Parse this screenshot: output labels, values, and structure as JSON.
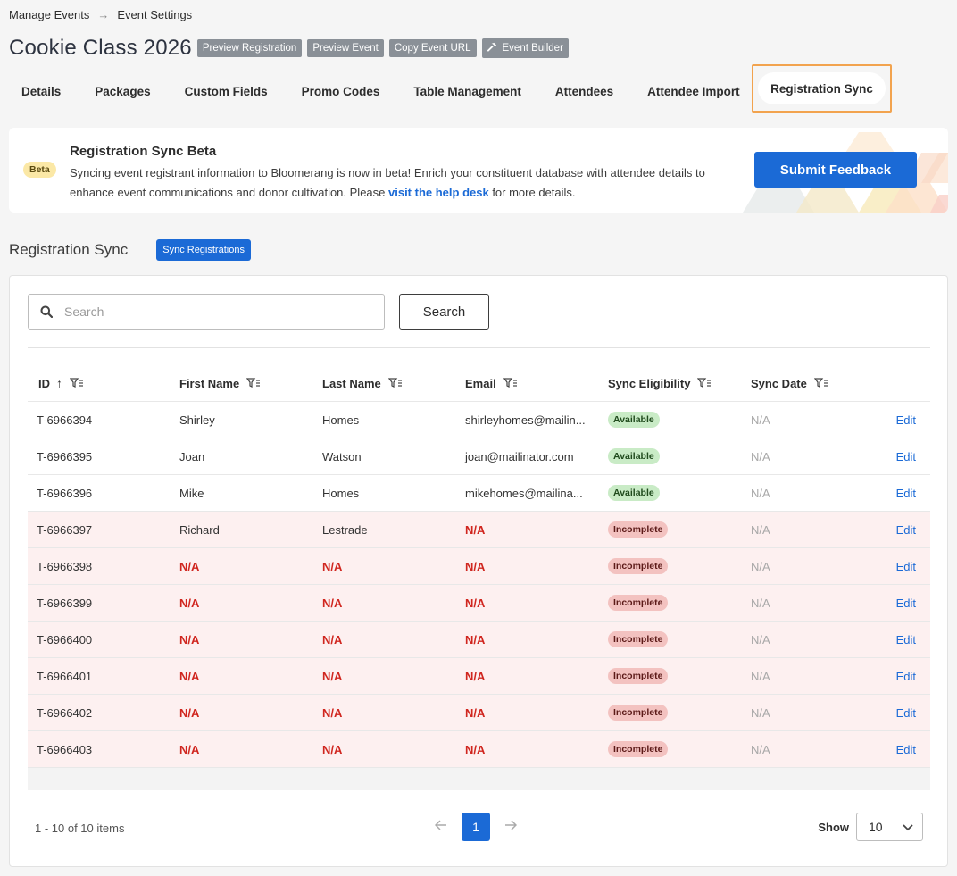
{
  "breadcrumb": {
    "items": [
      "Manage Events",
      "Event Settings"
    ],
    "separator": "→"
  },
  "header": {
    "title": "Cookie Class 2026",
    "actions": {
      "preview_registration": "Preview Registration",
      "preview_event": "Preview Event",
      "copy_event_url": "Copy Event URL",
      "event_builder": "Event Builder"
    }
  },
  "tabs": [
    {
      "label": "Details"
    },
    {
      "label": "Packages"
    },
    {
      "label": "Custom Fields"
    },
    {
      "label": "Promo Codes"
    },
    {
      "label": "Table Management"
    },
    {
      "label": "Attendees"
    },
    {
      "label": "Attendee Import"
    },
    {
      "label": "Registration Sync",
      "active": true
    }
  ],
  "banner": {
    "badge": "Beta",
    "title": "Registration Sync Beta",
    "text_before": "Syncing event registrant information to Bloomerang is now in beta! Enrich your constituent database with attendee details to enhance event communications and donor cultivation. Please ",
    "link": "visit the help desk",
    "text_after": " for more details.",
    "button": "Submit Feedback"
  },
  "section": {
    "title": "Registration Sync",
    "sync_button": "Sync Registrations"
  },
  "search": {
    "placeholder": "Search",
    "value": "",
    "button": "Search"
  },
  "table": {
    "columns": {
      "id": "ID",
      "first_name": "First Name",
      "last_name": "Last Name",
      "email": "Email",
      "sync_eligibility": "Sync Eligibility",
      "sync_date": "Sync Date"
    },
    "edit_label": "Edit",
    "rows": [
      {
        "id": "T-6966394",
        "first_name": "Shirley",
        "last_name": "Homes",
        "email": "shirleyhomes@mailin...",
        "status": "Available",
        "sync_date": "N/A"
      },
      {
        "id": "T-6966395",
        "first_name": "Joan",
        "last_name": "Watson",
        "email": "joan@mailinator.com",
        "status": "Available",
        "sync_date": "N/A"
      },
      {
        "id": "T-6966396",
        "first_name": "Mike",
        "last_name": "Homes",
        "email": "mikehomes@mailina...",
        "status": "Available",
        "sync_date": "N/A"
      },
      {
        "id": "T-6966397",
        "first_name": "Richard",
        "last_name": "Lestrade",
        "email": "N/A",
        "status": "Incomplete",
        "sync_date": "N/A"
      },
      {
        "id": "T-6966398",
        "first_name": "N/A",
        "last_name": "N/A",
        "email": "N/A",
        "status": "Incomplete",
        "sync_date": "N/A"
      },
      {
        "id": "T-6966399",
        "first_name": "N/A",
        "last_name": "N/A",
        "email": "N/A",
        "status": "Incomplete",
        "sync_date": "N/A"
      },
      {
        "id": "T-6966400",
        "first_name": "N/A",
        "last_name": "N/A",
        "email": "N/A",
        "status": "Incomplete",
        "sync_date": "N/A"
      },
      {
        "id": "T-6966401",
        "first_name": "N/A",
        "last_name": "N/A",
        "email": "N/A",
        "status": "Incomplete",
        "sync_date": "N/A"
      },
      {
        "id": "T-6966402",
        "first_name": "N/A",
        "last_name": "N/A",
        "email": "N/A",
        "status": "Incomplete",
        "sync_date": "N/A"
      },
      {
        "id": "T-6966403",
        "first_name": "N/A",
        "last_name": "N/A",
        "email": "N/A",
        "status": "Incomplete",
        "sync_date": "N/A"
      }
    ]
  },
  "pagination": {
    "summary": "1 - 10 of 10 items",
    "current_page": "1",
    "show_label": "Show",
    "page_size": "10"
  },
  "colors": {
    "accent": "#1b6ad6",
    "active_tab_outline": "#f2a34e",
    "error_text": "#d0261f",
    "available_bg": "#c9ebc6",
    "incomplete_bg": "#f3c2c0"
  }
}
